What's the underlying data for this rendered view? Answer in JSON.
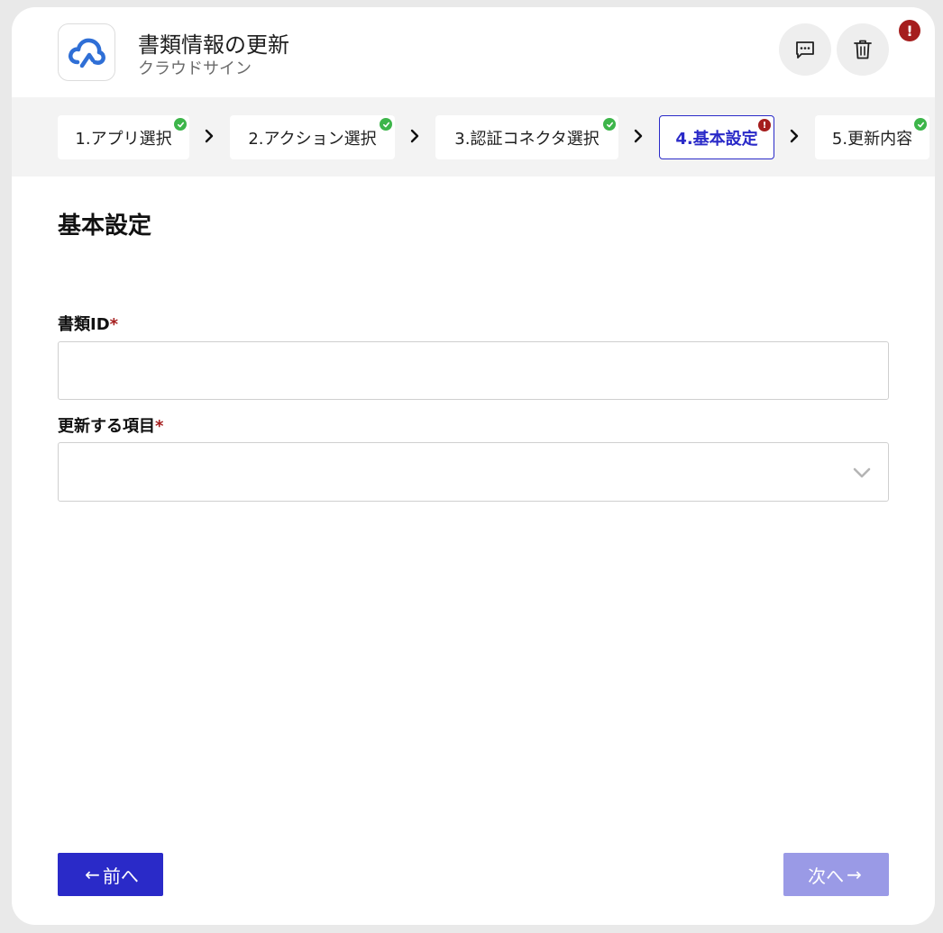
{
  "header": {
    "title": "書類情報の更新",
    "app_name": "クラウドサイン",
    "logo_icon": "cloud-sign-logo",
    "alert_badge": "!"
  },
  "steps": [
    {
      "label": "1.アプリ選択",
      "status": "complete"
    },
    {
      "label": "2.アクション選択",
      "status": "complete"
    },
    {
      "label": "3.認証コネクタ選択",
      "status": "complete"
    },
    {
      "label": "4.基本設定",
      "status": "error",
      "badge": "!"
    },
    {
      "label": "5.更新内容",
      "status": "complete"
    }
  ],
  "section": {
    "title": "基本設定"
  },
  "fields": {
    "document_id": {
      "label": "書類ID",
      "required_mark": "*",
      "value": ""
    },
    "update_item": {
      "label": "更新する項目",
      "required_mark": "*",
      "value": ""
    }
  },
  "footer": {
    "prev_label": "前へ",
    "prev_arrow": "←",
    "next_label": "次へ",
    "next_arrow": "→"
  },
  "colors": {
    "primary": "#2a2ac8",
    "primary_disabled": "#9a9ae6",
    "success": "#3db54a",
    "error": "#a51d1d"
  }
}
